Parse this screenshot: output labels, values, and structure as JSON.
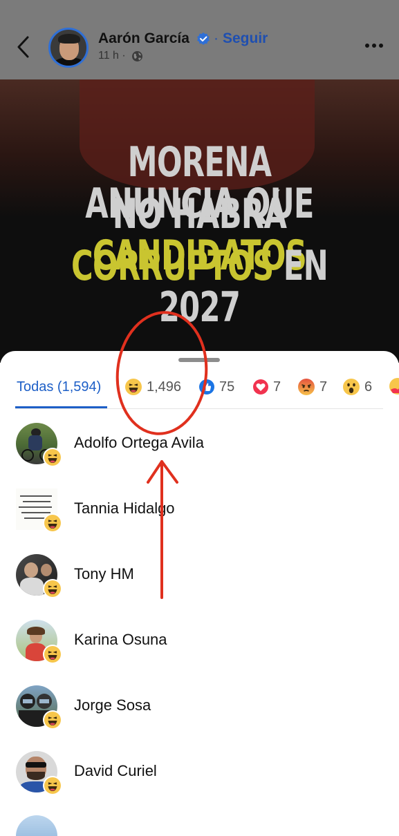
{
  "header": {
    "author_name": "Aarón García",
    "separator": "·",
    "follow_label": "Seguir",
    "time": "11 h ·"
  },
  "post_image": {
    "headline_line1": "MORENA ANUNCIA QUE",
    "headline_line2_a": "NO HABRÁ ",
    "headline_line2_b": "CANDIDATOS",
    "headline_line3_a": "CORRUPTOS",
    "headline_line3_b": " EN 2027"
  },
  "reactions": {
    "tabs": [
      {
        "label": "Todas (1,594)",
        "icon": null
      },
      {
        "label": "1,496",
        "icon": "haha-icon"
      },
      {
        "label": "75",
        "icon": "like-icon"
      },
      {
        "label": "7",
        "icon": "love-icon"
      },
      {
        "label": "7",
        "icon": "angry-icon"
      },
      {
        "label": "6",
        "icon": "wow-icon"
      }
    ],
    "people": [
      {
        "name": "Adolfo Ortega Avila"
      },
      {
        "name": "Tannia Hidalgo"
      },
      {
        "name": "Tony HM"
      },
      {
        "name": "Karina Osuna"
      },
      {
        "name": "Jorge Sosa"
      },
      {
        "name": "David Curiel"
      }
    ]
  },
  "colors": {
    "accent_blue": "#1d5fc7",
    "annotation_red": "#e0301e",
    "headline_yellow": "#c9c530"
  }
}
